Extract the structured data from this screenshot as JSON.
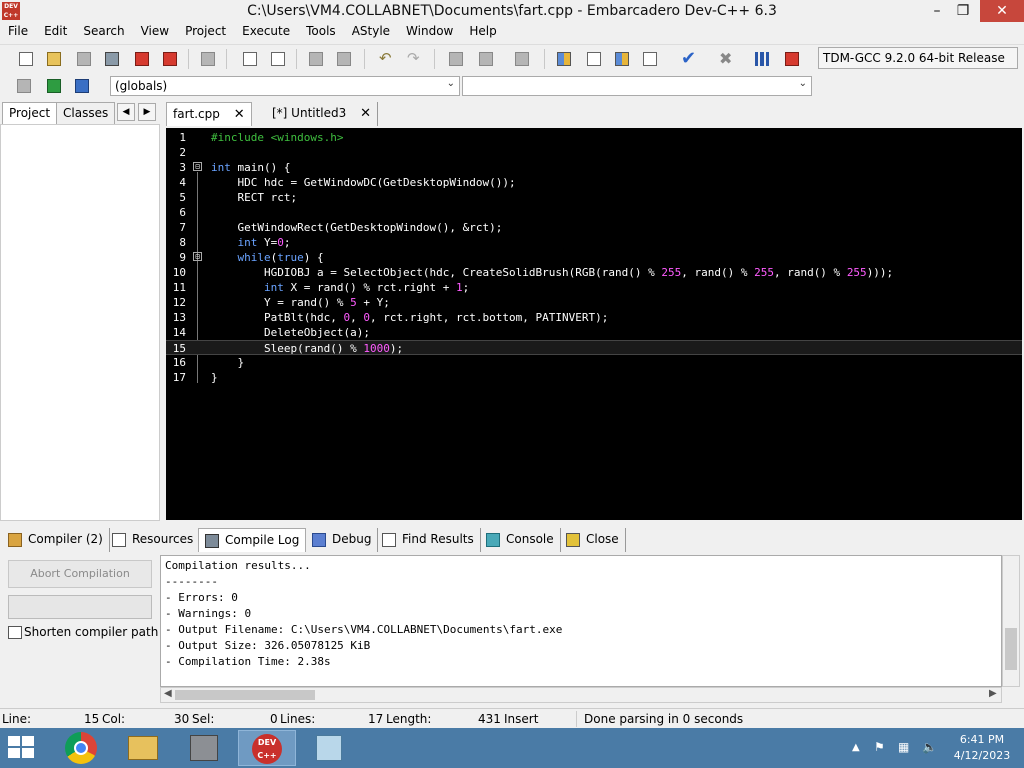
{
  "window": {
    "title": "C:\\Users\\VM4.COLLABNET\\Documents\\fart.cpp - Embarcadero Dev-C++ 6.3",
    "logo_text": "DEV C++"
  },
  "menu": [
    "File",
    "Edit",
    "Search",
    "View",
    "Project",
    "Execute",
    "Tools",
    "AStyle",
    "Window",
    "Help"
  ],
  "compiler": {
    "selected": "TDM-GCC 9.2.0 64-bit Release"
  },
  "scope": {
    "selected": "(globals)"
  },
  "left_tabs": {
    "project": "Project",
    "classes": "Classes",
    "prev": "◀",
    "next": "▶"
  },
  "editor_tabs": [
    {
      "label": "fart.cpp",
      "close": "✕"
    },
    {
      "label": "[*] Untitled3",
      "close": "✕"
    }
  ],
  "code": {
    "lines": [
      {
        "n": "1",
        "tokens": [
          [
            "pre",
            "#include <windows.h>"
          ]
        ]
      },
      {
        "n": "2",
        "tokens": []
      },
      {
        "n": "3",
        "tokens": [
          [
            "kw",
            "int"
          ],
          [
            "txt",
            " main() {"
          ]
        ]
      },
      {
        "n": "4",
        "tokens": [
          [
            "txt",
            "    HDC hdc = GetWindowDC(GetDesktopWindow());"
          ]
        ]
      },
      {
        "n": "5",
        "tokens": [
          [
            "txt",
            "    RECT rct;"
          ]
        ]
      },
      {
        "n": "6",
        "tokens": []
      },
      {
        "n": "7",
        "tokens": [
          [
            "txt",
            "    GetWindowRect(GetDesktopWindow(), &rct);"
          ]
        ]
      },
      {
        "n": "8",
        "tokens": [
          [
            "kw",
            "    int"
          ],
          [
            "txt",
            " Y="
          ],
          [
            "num",
            "0"
          ],
          [
            "txt",
            ";"
          ]
        ]
      },
      {
        "n": "9",
        "tokens": [
          [
            "kw",
            "    while"
          ],
          [
            "txt",
            "("
          ],
          [
            "kw",
            "true"
          ],
          [
            "txt",
            ") {"
          ]
        ]
      },
      {
        "n": "10",
        "tokens": [
          [
            "txt",
            "        HGDIOBJ a = SelectObject(hdc, CreateSolidBrush(RGB(rand() % "
          ],
          [
            "num",
            "255"
          ],
          [
            "txt",
            ", rand() % "
          ],
          [
            "num",
            "255"
          ],
          [
            "txt",
            ", rand() % "
          ],
          [
            "num",
            "255"
          ],
          [
            "txt",
            ")));"
          ]
        ]
      },
      {
        "n": "11",
        "tokens": [
          [
            "kw",
            "        int"
          ],
          [
            "txt",
            " X = rand() % rct.right + "
          ],
          [
            "num",
            "1"
          ],
          [
            "txt",
            ";"
          ]
        ]
      },
      {
        "n": "12",
        "tokens": [
          [
            "txt",
            "        Y = rand() % "
          ],
          [
            "num",
            "5"
          ],
          [
            "txt",
            " + Y;"
          ]
        ]
      },
      {
        "n": "13",
        "tokens": [
          [
            "txt",
            "        PatBlt(hdc, "
          ],
          [
            "num",
            "0"
          ],
          [
            "txt",
            ", "
          ],
          [
            "num",
            "0"
          ],
          [
            "txt",
            ", rct.right, rct.bottom, PATINVERT);"
          ]
        ]
      },
      {
        "n": "14",
        "tokens": [
          [
            "txt",
            "        DeleteObject(a);"
          ]
        ]
      },
      {
        "n": "15",
        "tokens": [
          [
            "txt",
            "        Sleep(rand() % "
          ],
          [
            "num",
            "1000"
          ],
          [
            "txt",
            ");"
          ]
        ]
      },
      {
        "n": "16",
        "tokens": [
          [
            "txt",
            "    }"
          ]
        ]
      },
      {
        "n": "17",
        "tokens": [
          [
            "txt",
            "}"
          ]
        ]
      }
    ],
    "current_line": 15,
    "fold_markers": [
      "⊟",
      "⊟"
    ]
  },
  "bottom_tabs": [
    {
      "label": "Compiler (2)",
      "icon": "compiler-icon"
    },
    {
      "label": "Resources",
      "icon": "resources-icon"
    },
    {
      "label": "Compile Log",
      "icon": "compile-log-icon"
    },
    {
      "label": "Debug",
      "icon": "debug-icon"
    },
    {
      "label": "Find Results",
      "icon": "find-results-icon"
    },
    {
      "label": "Console",
      "icon": "console-icon"
    },
    {
      "label": "Close",
      "icon": "close-icon"
    }
  ],
  "compile_panel": {
    "abort_label": "Abort Compilation",
    "shorten_label": "Shorten compiler paths",
    "shorten_checked": false,
    "log": "Compilation results...\n--------\n- Errors: 0\n- Warnings: 0\n- Output Filename: C:\\Users\\VM4.COLLABNET\\Documents\\fart.exe\n- Output Size: 326.05078125 KiB\n- Compilation Time: 2.38s"
  },
  "status": {
    "line_label": "Line:",
    "line_value": "15",
    "col_label": "Col:",
    "col_value": "30",
    "sel_label": "Sel:",
    "sel_value": "0",
    "lines_label": "Lines:",
    "lines_value": "17",
    "length_label": "Length:",
    "length_value": "431",
    "mode": "Insert",
    "message": "Done parsing in 0 seconds"
  },
  "taskbar": {
    "devcpp_text": "DEV C++",
    "time": "6:41 PM",
    "date": "4/12/2023",
    "tray_arrow": "▲"
  },
  "colors": {
    "editor_bg": "#000000",
    "preprocessor": "#3fbf3f",
    "keyword": "#6aa3ff",
    "number": "#ff5cff",
    "taskbar": "#4a7ba6",
    "close_button": "#c7473c"
  }
}
